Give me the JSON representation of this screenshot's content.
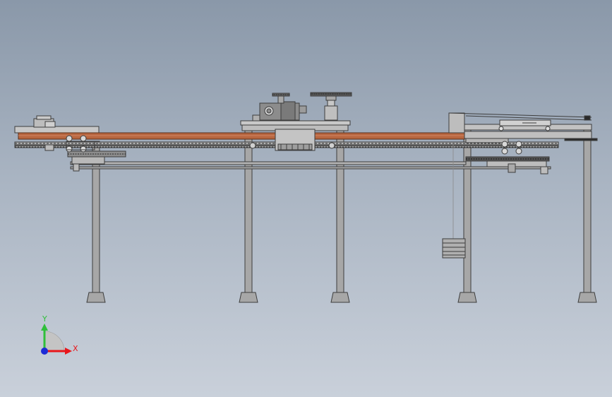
{
  "triad": {
    "x_label": "X",
    "y_label": "Y",
    "x_color": "#e8161b",
    "y_color": "#2fbf3a",
    "z_color": "#1d2bd6"
  },
  "colors": {
    "belt": "#b8663f",
    "frame_stroke": "#3d3d3d",
    "frame_fill": "#9d9d9d",
    "leg_fill": "#a7a7a7",
    "motor_fill": "#8c8c8c",
    "chain": "#2a2a2a"
  },
  "scene": {
    "view": "front",
    "icons": [
      "conveyor-assembly",
      "gear-motor",
      "sprocket",
      "support-leg",
      "coordinate-triad"
    ]
  }
}
